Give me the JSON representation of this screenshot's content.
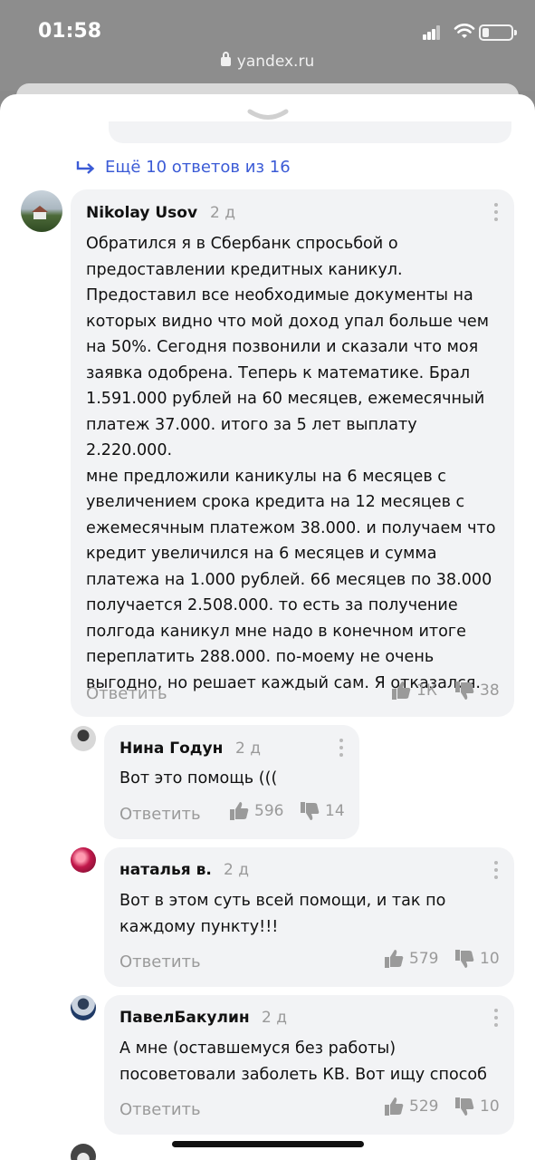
{
  "status": {
    "time": "01:58",
    "url": "yandex.ru"
  },
  "more_replies": "Ещё 10 ответов из 16",
  "comments": [
    {
      "author": "Nikolay Usov",
      "date": "2 д",
      "text": "Обратился я в Сбербанк спросьбой о\nпредоставлении кредитных каникул.\nПредоставил все необходимые документы на\nкоторых видно что мой доход упал больше чем\nна 50%. Сегодня позвонили и сказали что моя\nзаявка одобрена. Теперь к математике. Брал\n1.591.000 рублей на 60 месяцев, ежемесячный\nплатеж 37.000. итого за 5 лет выплату 2.220.000.\nмне предложили каникулы на 6 месяцев с\nувеличением срока кредита на 12 месяцев с\nежемесячным платежом 38.000. и получаем что\nкредит увеличился на 6 месяцев и сумма\nплатежа на 1.000 рублей. 66 месяцев по 38.000\nполучается 2.508.000. то есть за получение\nполгода каникул мне надо в конечном итоге\nпереплатить 288.000. по-моему не очень\nвыгодно, но решает каждый сам. Я отказался.",
      "reply": "Ответить",
      "likes": "1К",
      "dislikes": "38"
    },
    {
      "author": "Нина Годун",
      "date": "2 д",
      "text": "Вот это помощь (((",
      "reply": "Ответить",
      "likes": "596",
      "dislikes": "14"
    },
    {
      "author": "наталья в.",
      "date": "2 д",
      "text": "Вот в этом суть всей помощи, и так по\nкаждому пункту!!!",
      "reply": "Ответить",
      "likes": "579",
      "dislikes": "10"
    },
    {
      "author": "ПавелБакулин",
      "date": "2 д",
      "text": "А мне (оставшемуся без работы)\nпосоветовали заболеть КВ.  Вот ищу способ",
      "reply": "Ответить",
      "likes": "529",
      "dislikes": "10"
    }
  ],
  "colors": {
    "link": "#3b5bd6",
    "bubble": "#f2f3f5",
    "muted": "#9a9a9a"
  }
}
